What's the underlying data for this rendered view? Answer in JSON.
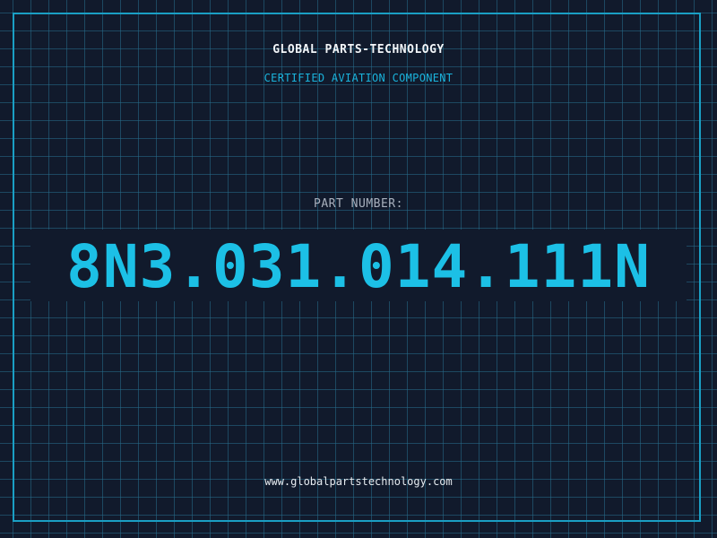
{
  "header": {
    "company": "GLOBAL PARTS-TECHNOLOGY",
    "tagline": "CERTIFIED AVIATION COMPONENT"
  },
  "part": {
    "label": "PART NUMBER:",
    "number": "8N3.031.014.111N"
  },
  "footer": {
    "website": "www.globalpartstechnology.com"
  },
  "colors": {
    "background": "#111a2c",
    "grid": "#266e8c",
    "frame": "#1a9fc4",
    "accent": "#1cc0e6",
    "text": "#f2f5f8",
    "muted": "#a8b0bd"
  }
}
